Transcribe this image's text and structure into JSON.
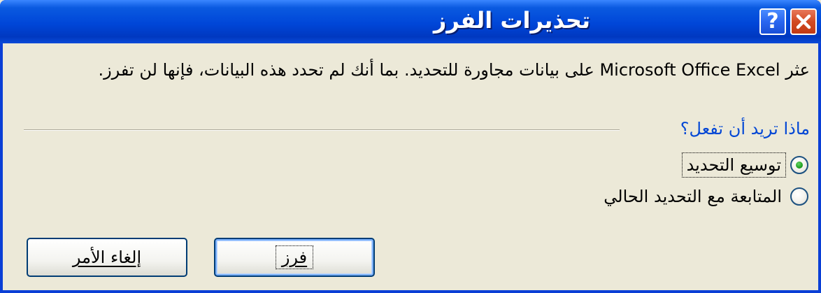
{
  "window": {
    "title": "تحذيرات الفرز",
    "help_icon": "question-mark-icon",
    "close_icon": "close-x-icon",
    "colors": {
      "titlebar": "#0a4ad8",
      "close_button": "#d24a22",
      "background": "#ece9d8",
      "group_label": "#0046d5"
    }
  },
  "message": "عثر Microsoft Office Excel على بيانات مجاورة للتحديد. بما أنك لم تحدد هذه البيانات، فإنها لن تفرز.",
  "options": {
    "group_label": "ماذا تريد أن تفعل؟",
    "items": [
      {
        "label": "توسيع التحديد",
        "selected": true
      },
      {
        "label": "المتابعة مع التحديد الحالي",
        "selected": false
      }
    ]
  },
  "buttons": {
    "sort_label": "فرز",
    "cancel_label": "إلغاء الأمر"
  }
}
